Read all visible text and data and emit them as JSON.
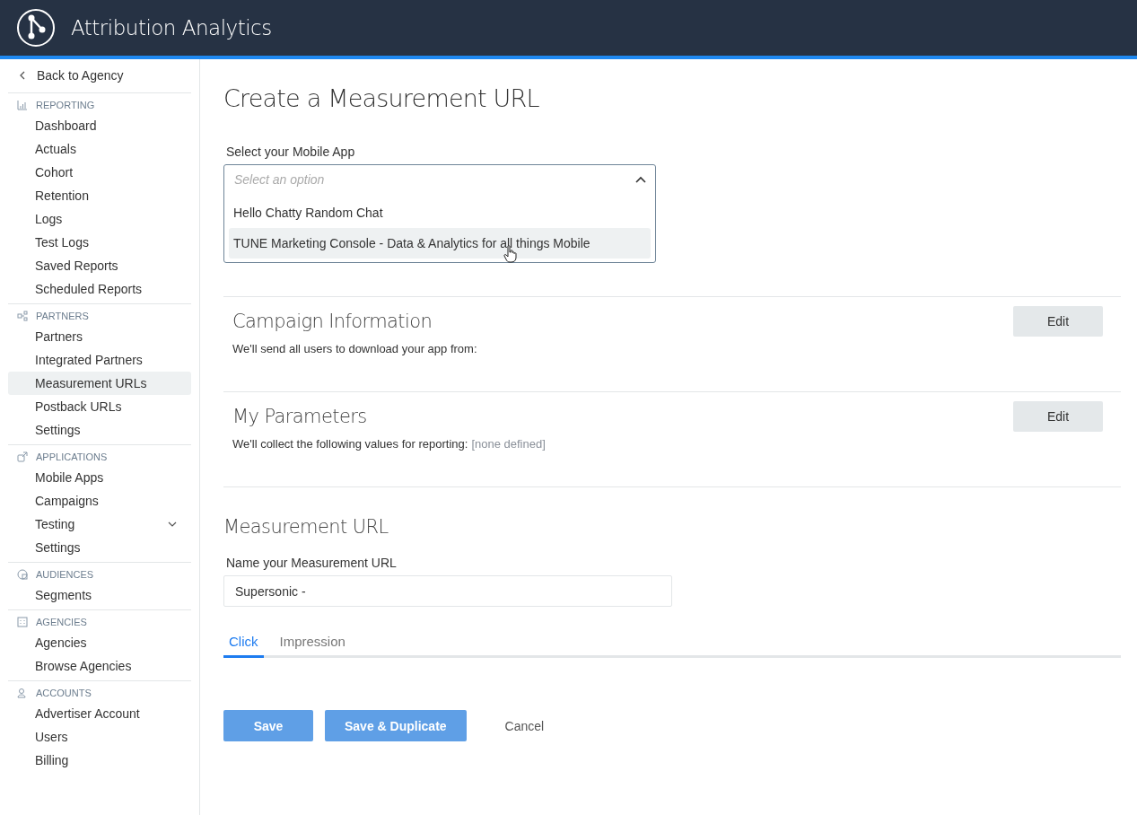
{
  "header": {
    "title": "Attribution Analytics"
  },
  "sidebar": {
    "back": "Back to Agency",
    "sections": [
      {
        "heading": "REPORTING",
        "kind": "chart",
        "items": [
          {
            "label": "Dashboard",
            "selected": false
          },
          {
            "label": "Actuals",
            "selected": false
          },
          {
            "label": "Cohort",
            "selected": false
          },
          {
            "label": "Retention",
            "selected": false
          },
          {
            "label": "Logs",
            "selected": false
          },
          {
            "label": "Test Logs",
            "selected": false
          },
          {
            "label": "Saved Reports",
            "selected": false
          },
          {
            "label": "Scheduled Reports",
            "selected": false
          }
        ]
      },
      {
        "heading": "PARTNERS",
        "kind": "partners",
        "items": [
          {
            "label": "Partners",
            "selected": false
          },
          {
            "label": "Integrated Partners",
            "selected": false
          },
          {
            "label": "Measurement URLs",
            "selected": true
          },
          {
            "label": "Postback URLs",
            "selected": false
          },
          {
            "label": "Settings",
            "selected": false
          }
        ]
      },
      {
        "heading": "APPLICATIONS",
        "kind": "apps",
        "items": [
          {
            "label": "Mobile Apps",
            "selected": false
          },
          {
            "label": "Campaigns",
            "selected": false
          },
          {
            "label": "Testing",
            "selected": false,
            "expanded": false
          },
          {
            "label": "Settings",
            "selected": false
          }
        ]
      },
      {
        "heading": "AUDIENCES",
        "kind": "audiences",
        "items": [
          {
            "label": "Segments",
            "selected": false
          }
        ]
      },
      {
        "heading": "AGENCIES",
        "kind": "agencies",
        "items": [
          {
            "label": "Agencies",
            "selected": false
          },
          {
            "label": "Browse Agencies",
            "selected": false
          }
        ]
      },
      {
        "heading": "ACCOUNTS",
        "kind": "accounts",
        "items": [
          {
            "label": "Advertiser Account",
            "selected": false
          },
          {
            "label": "Users",
            "selected": false
          },
          {
            "label": "Billing",
            "selected": false
          }
        ]
      }
    ]
  },
  "page_title": "Create a Measurement URL",
  "app_select": {
    "label": "Select your Mobile App",
    "placeholder": "Select an option",
    "expanded": true,
    "options": [
      {
        "label": "Hello Chatty Random Chat",
        "highlighted": false
      },
      {
        "label": "TUNE Marketing Console - Data & Analytics for all things Mobile",
        "highlighted": true
      }
    ]
  },
  "sections": [
    {
      "title": "Campaign Information",
      "button": "Edit",
      "text": "We'll send all users to download your app from:"
    },
    {
      "title": "My Parameters",
      "button": "Edit",
      "text": "We'll collect the following values for reporting:",
      "note": "[none defined]"
    }
  ],
  "measurement_url": {
    "title": "Measurement URL",
    "label": "Name your Measurement URL",
    "value": "Supersonic -"
  },
  "tabs": [
    {
      "label": "Click",
      "selected": true
    },
    {
      "label": "Impression",
      "selected": false
    }
  ],
  "actions": [
    {
      "label": "Save",
      "kind": "primary",
      "disabled": true
    },
    {
      "label": "Save & Duplicate",
      "kind": "primary",
      "disabled": true
    },
    {
      "label": "Cancel",
      "kind": "link",
      "disabled": false
    }
  ]
}
